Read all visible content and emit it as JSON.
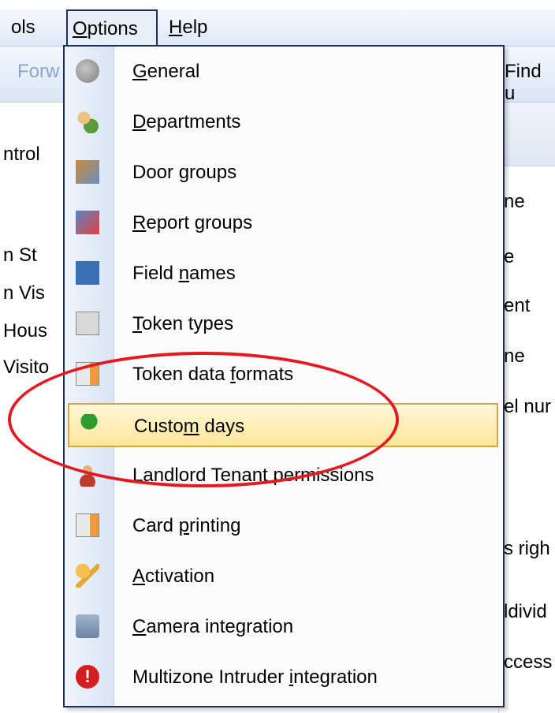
{
  "menubar": {
    "tools_label": "ols",
    "options_label": "Options",
    "help_label": "Help"
  },
  "toolbar": {
    "forward_label": "Forw",
    "find_label": "Find u"
  },
  "left_pane": {
    "lines": [
      "ntrol",
      "n St",
      "n Vis",
      "Hous",
      "Visito"
    ]
  },
  "right_pane": {
    "lines": [
      "ne",
      "e",
      "ent",
      "ne",
      "el nur",
      "s righ",
      "ldivid",
      "ccess"
    ]
  },
  "options_menu": {
    "items": [
      {
        "pre": "",
        "ul": "G",
        "post": "eneral",
        "icon": "gear-icon"
      },
      {
        "pre": "",
        "ul": "D",
        "post": "epartments",
        "icon": "people-icon"
      },
      {
        "pre": "Door ",
        "ul": "g",
        "post": "roups",
        "icon": "door-icon"
      },
      {
        "pre": "",
        "ul": "R",
        "post": "eport groups",
        "icon": "report-icon"
      },
      {
        "pre": "Field ",
        "ul": "n",
        "post": "ames",
        "icon": "field-icon"
      },
      {
        "pre": "",
        "ul": "T",
        "post": "oken types",
        "icon": "card-icon"
      },
      {
        "pre": "Token data ",
        "ul": "f",
        "post": "ormats",
        "icon": "card-icon"
      },
      {
        "pre": "Custo",
        "ul": "m",
        "post": " days",
        "icon": "palm-tree-icon",
        "selected": true
      },
      {
        "pre": "Landlord Tenant permissions",
        "ul": "",
        "post": "",
        "icon": "person-icon"
      },
      {
        "pre": "Card ",
        "ul": "p",
        "post": "rinting",
        "icon": "card-icon"
      },
      {
        "pre": "",
        "ul": "A",
        "post": "ctivation",
        "icon": "key-icon"
      },
      {
        "pre": "",
        "ul": "C",
        "post": "amera integration",
        "icon": "camera-icon"
      },
      {
        "pre": "Multizone Intruder ",
        "ul": "i",
        "post": "ntegration",
        "icon": "alert-icon"
      }
    ]
  },
  "annotation": {
    "highlight_color": "#e21b23"
  }
}
